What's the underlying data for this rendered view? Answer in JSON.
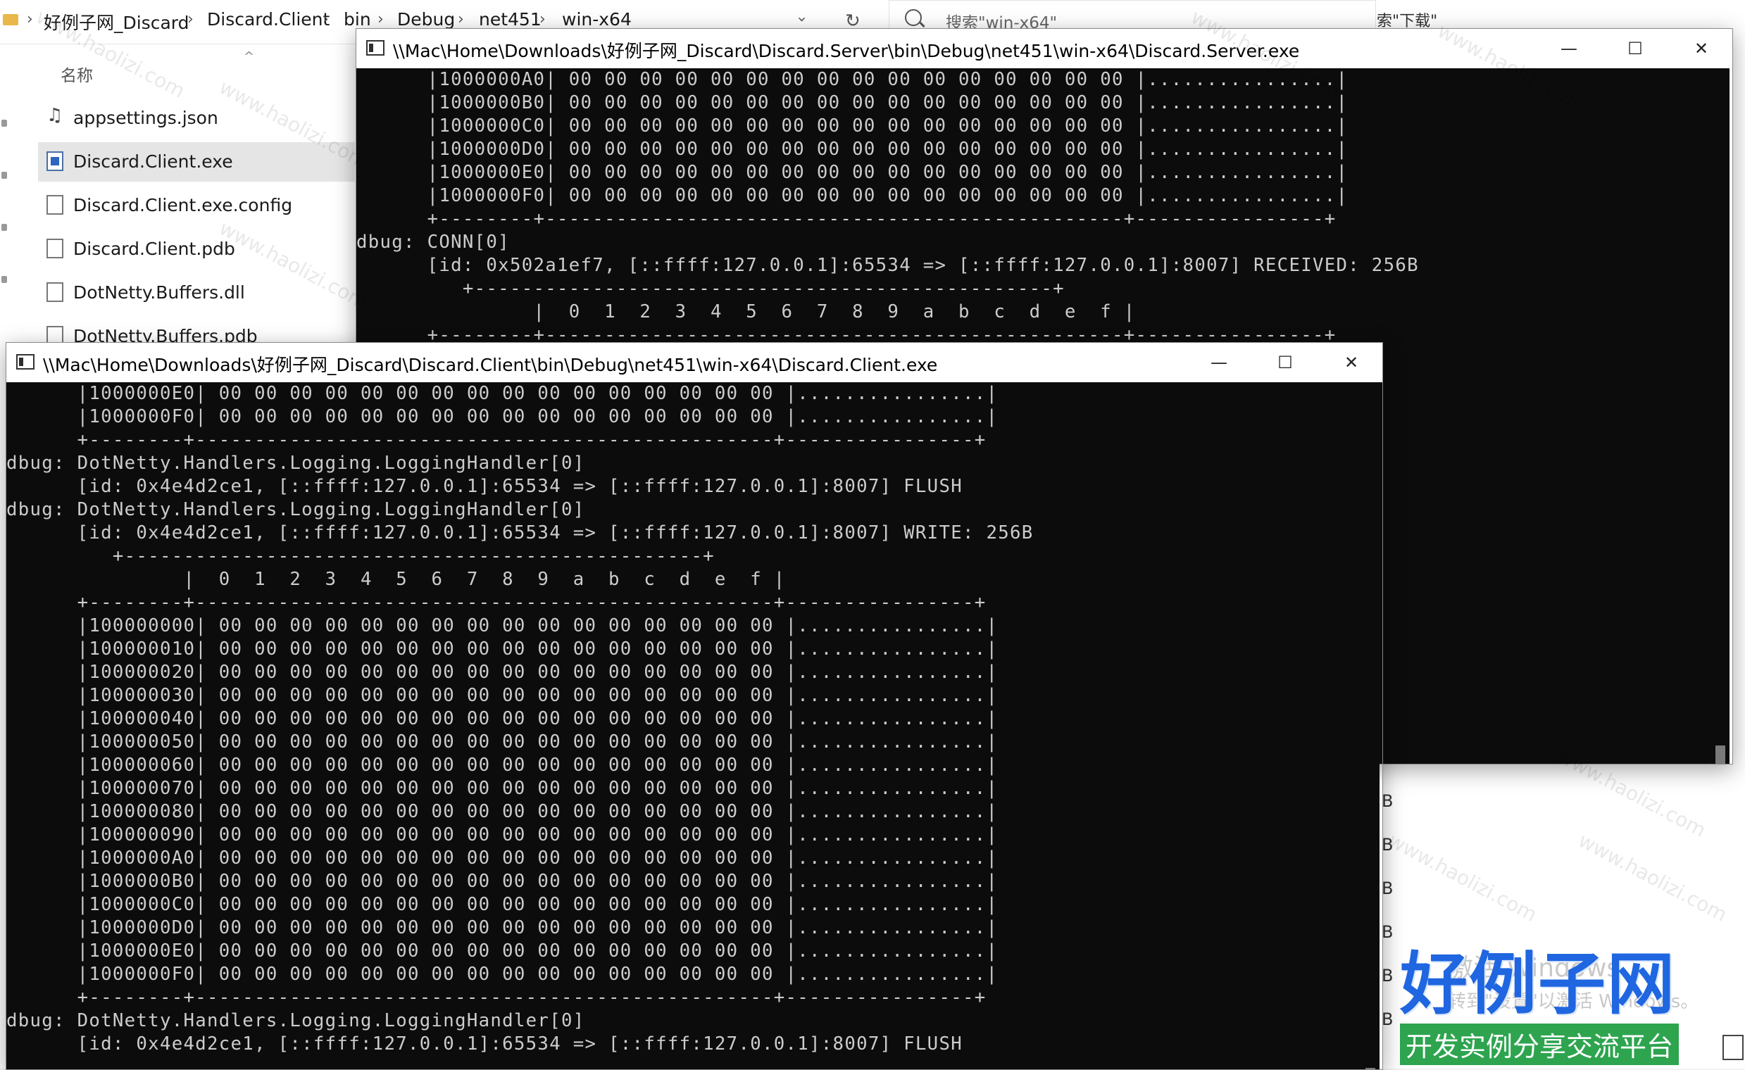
{
  "explorer": {
    "breadcrumb": [
      "好例子网_Discard",
      "Discard.Client",
      "bin",
      "Debug",
      "net451",
      "win-x64"
    ],
    "search_placeholder": "搜索\"win-x64\"",
    "right_search_text": "索\"下载\"",
    "column_name": "名称",
    "files": [
      {
        "name": "appsettings.json",
        "icon": "json-file-icon",
        "selected": false
      },
      {
        "name": "Discard.Client.exe",
        "icon": "exe-file-icon",
        "selected": true
      },
      {
        "name": "Discard.Client.exe.config",
        "icon": "config-file-icon",
        "selected": false
      },
      {
        "name": "Discard.Client.pdb",
        "icon": "pdb-file-icon",
        "selected": false
      },
      {
        "name": "DotNetty.Buffers.dll",
        "icon": "dll-file-icon",
        "selected": false
      },
      {
        "name": "DotNetty.Buffers.pdb",
        "icon": "pdb-file-icon",
        "selected": false
      }
    ],
    "size_column_marks": [
      "B",
      "B",
      "B",
      "B",
      "B",
      "B"
    ],
    "activation_line1": "激活 Windows",
    "activation_line2": "转到\"设置\"以激活 Windows。"
  },
  "watermark": {
    "text": "www.haolizi.com",
    "logo_big": "好例子网",
    "logo_small": "开发实例分享交流平台"
  },
  "server_window": {
    "title": "\\\\Mac\\Home\\Downloads\\好例子网_Discard\\Discard.Server\\bin\\Debug\\net451\\win-x64\\Discard.Server.exe",
    "buttons": {
      "minimize": "—",
      "maximize": "☐",
      "close": "✕"
    },
    "console_lines": [
      "      |1000000A0| 00 00 00 00 00 00 00 00 00 00 00 00 00 00 00 00 |................|",
      "      |1000000B0| 00 00 00 00 00 00 00 00 00 00 00 00 00 00 00 00 |................|",
      "      |1000000C0| 00 00 00 00 00 00 00 00 00 00 00 00 00 00 00 00 |................|",
      "      |1000000D0| 00 00 00 00 00 00 00 00 00 00 00 00 00 00 00 00 |................|",
      "      |1000000E0| 00 00 00 00 00 00 00 00 00 00 00 00 00 00 00 00 |................|",
      "      |1000000F0| 00 00 00 00 00 00 00 00 00 00 00 00 00 00 00 00 |................|",
      "      +--------+-------------------------------------------------+----------------+",
      "dbug: CONN[0]",
      "      [id: 0x502a1ef7, [::ffff:127.0.0.1]:65534 => [::ffff:127.0.0.1]:8007] RECEIVED: 256B",
      "         +-------------------------------------------------+",
      "               |  0  1  2  3  4  5  6  7  8  9  a  b  c  d  e  f |",
      "      +--------+-------------------------------------------------+----------------+"
    ]
  },
  "client_window": {
    "title": "\\\\Mac\\Home\\Downloads\\好例子网_Discard\\Discard.Client\\bin\\Debug\\net451\\win-x64\\Discard.Client.exe",
    "buttons": {
      "minimize": "—",
      "maximize": "☐",
      "close": "✕"
    },
    "console_lines": [
      "      |1000000E0| 00 00 00 00 00 00 00 00 00 00 00 00 00 00 00 00 |................|",
      "      |1000000F0| 00 00 00 00 00 00 00 00 00 00 00 00 00 00 00 00 |................|",
      "      +--------+-------------------------------------------------+----------------+",
      "dbug: DotNetty.Handlers.Logging.LoggingHandler[0]",
      "      [id: 0x4e4d2ce1, [::ffff:127.0.0.1]:65534 => [::ffff:127.0.0.1]:8007] FLUSH",
      "dbug: DotNetty.Handlers.Logging.LoggingHandler[0]",
      "      [id: 0x4e4d2ce1, [::ffff:127.0.0.1]:65534 => [::ffff:127.0.0.1]:8007] WRITE: 256B",
      "         +-------------------------------------------------+",
      "               |  0  1  2  3  4  5  6  7  8  9  a  b  c  d  e  f |",
      "      +--------+-------------------------------------------------+----------------+",
      "      |100000000| 00 00 00 00 00 00 00 00 00 00 00 00 00 00 00 00 |................|",
      "      |100000010| 00 00 00 00 00 00 00 00 00 00 00 00 00 00 00 00 |................|",
      "      |100000020| 00 00 00 00 00 00 00 00 00 00 00 00 00 00 00 00 |................|",
      "      |100000030| 00 00 00 00 00 00 00 00 00 00 00 00 00 00 00 00 |................|",
      "      |100000040| 00 00 00 00 00 00 00 00 00 00 00 00 00 00 00 00 |................|",
      "      |100000050| 00 00 00 00 00 00 00 00 00 00 00 00 00 00 00 00 |................|",
      "      |100000060| 00 00 00 00 00 00 00 00 00 00 00 00 00 00 00 00 |................|",
      "      |100000070| 00 00 00 00 00 00 00 00 00 00 00 00 00 00 00 00 |................|",
      "      |100000080| 00 00 00 00 00 00 00 00 00 00 00 00 00 00 00 00 |................|",
      "      |100000090| 00 00 00 00 00 00 00 00 00 00 00 00 00 00 00 00 |................|",
      "      |1000000A0| 00 00 00 00 00 00 00 00 00 00 00 00 00 00 00 00 |................|",
      "      |1000000B0| 00 00 00 00 00 00 00 00 00 00 00 00 00 00 00 00 |................|",
      "      |1000000C0| 00 00 00 00 00 00 00 00 00 00 00 00 00 00 00 00 |................|",
      "      |1000000D0| 00 00 00 00 00 00 00 00 00 00 00 00 00 00 00 00 |................|",
      "      |1000000E0| 00 00 00 00 00 00 00 00 00 00 00 00 00 00 00 00 |................|",
      "      |1000000F0| 00 00 00 00 00 00 00 00 00 00 00 00 00 00 00 00 |................|",
      "      +--------+-------------------------------------------------+----------------+",
      "dbug: DotNetty.Handlers.Logging.LoggingHandler[0]",
      "      [id: 0x4e4d2ce1, [::ffff:127.0.0.1]:65534 => [::ffff:127.0.0.1]:8007] FLUSH"
    ]
  }
}
